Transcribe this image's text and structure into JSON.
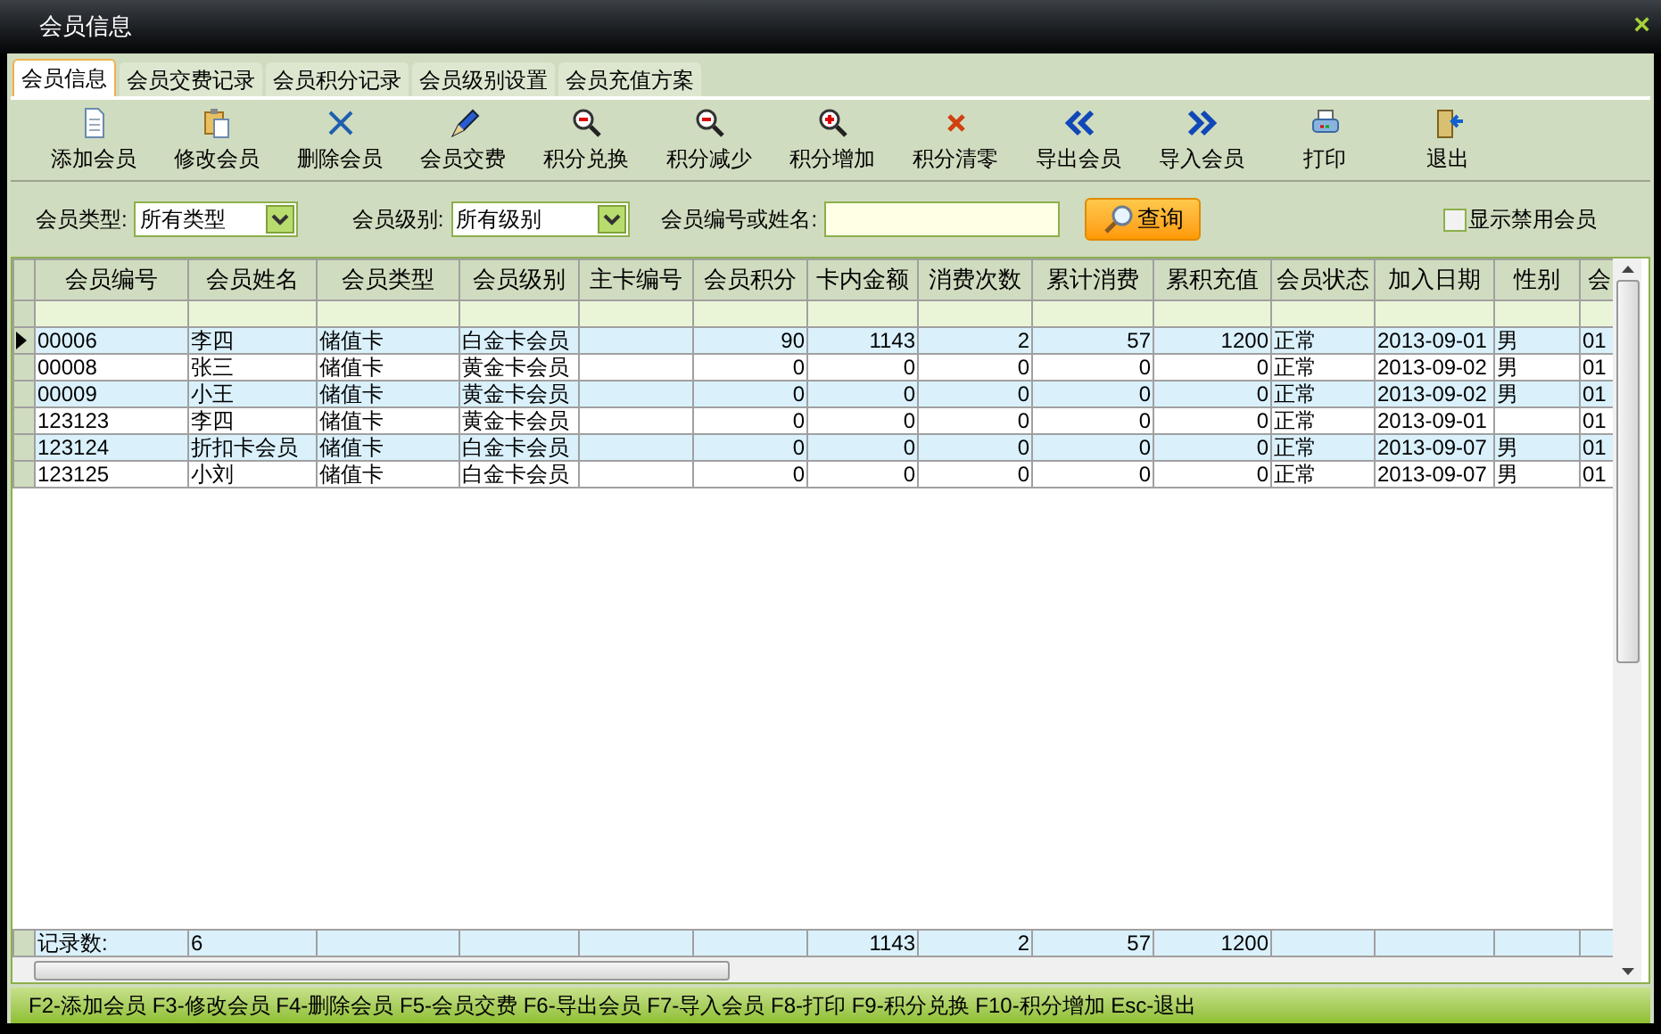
{
  "window": {
    "title": "会员信息",
    "close": "×"
  },
  "tabs": [
    {
      "label": "会员信息",
      "selected": true
    },
    {
      "label": "会员交费记录",
      "selected": false
    },
    {
      "label": "会员积分记录",
      "selected": false
    },
    {
      "label": "会员级别设置",
      "selected": false
    },
    {
      "label": "会员充值方案",
      "selected": false
    }
  ],
  "toolbar": [
    {
      "label": "添加会员",
      "kind": "document"
    },
    {
      "label": "修改会员",
      "kind": "clipboard"
    },
    {
      "label": "删除会员",
      "kind": "cross"
    },
    {
      "label": "会员交费",
      "kind": "pen"
    },
    {
      "label": "积分兑换",
      "kind": "zoom-minus"
    },
    {
      "label": "积分减少",
      "kind": "zoom-minus"
    },
    {
      "label": "积分增加",
      "kind": "zoom-plus"
    },
    {
      "label": "积分清零",
      "kind": "cross-bold"
    },
    {
      "label": "导出会员",
      "kind": "chevrons-left"
    },
    {
      "label": "导入会员",
      "kind": "chevrons-right"
    },
    {
      "label": "打印",
      "kind": "printer"
    },
    {
      "label": "退出",
      "kind": "door"
    }
  ],
  "filters": {
    "type_label": "会员类型:",
    "type_value": "所有类型",
    "level_label": "会员级别:",
    "level_value": "所有级别",
    "search_label": "会员编号或姓名:",
    "search_button": "查询",
    "show_disabled": {
      "label": "显示禁用会员",
      "checked": false
    }
  },
  "table": {
    "columns": [
      "会员编号",
      "会员姓名",
      "会员类型",
      "会员级别",
      "主卡编号",
      "会员积分",
      "卡内金额",
      "消费次数",
      "累计消费",
      "累积充值",
      "会员状态",
      "加入日期",
      "性别",
      "会"
    ],
    "rows": [
      {
        "selected": true,
        "cells": [
          "00006",
          "李四",
          "储值卡",
          "白金卡会员",
          "",
          "90",
          "1143",
          "2",
          "57",
          "1200",
          "正常",
          "2013-09-01",
          "男",
          "01"
        ]
      },
      {
        "selected": false,
        "cells": [
          "00008",
          "张三",
          "储值卡",
          "黄金卡会员",
          "",
          "0",
          "0",
          "0",
          "0",
          "0",
          "正常",
          "2013-09-02",
          "男",
          "01"
        ]
      },
      {
        "selected": false,
        "cells": [
          "00009",
          "小王",
          "储值卡",
          "黄金卡会员",
          "",
          "0",
          "0",
          "0",
          "0",
          "0",
          "正常",
          "2013-09-02",
          "男",
          "01"
        ]
      },
      {
        "selected": false,
        "cells": [
          "123123",
          "李四",
          "储值卡",
          "黄金卡会员",
          "",
          "0",
          "0",
          "0",
          "0",
          "0",
          "正常",
          "2013-09-01",
          "",
          "01"
        ]
      },
      {
        "selected": false,
        "cells": [
          "123124",
          "折扣卡会员",
          "储值卡",
          "白金卡会员",
          "",
          "0",
          "0",
          "0",
          "0",
          "0",
          "正常",
          "2013-09-07",
          "男",
          "01"
        ]
      },
      {
        "selected": false,
        "cells": [
          "123125",
          "小刘",
          "储值卡",
          "白金卡会员",
          "",
          "0",
          "0",
          "0",
          "0",
          "0",
          "正常",
          "2013-09-07",
          "男",
          "01"
        ]
      }
    ],
    "footer": {
      "label": "记录数:",
      "record_count": "6",
      "card_balance": "1143",
      "purchase_count": "2",
      "total_spent": "57",
      "total_recharged": "1200"
    }
  },
  "status_bar": "F2-添加会员 F3-修改会员 F4-删除会员 F5-会员交费 F6-导出会员 F7-导入会员 F8-打印 F9-积分兑换 F10-积分增加 Esc-退出"
}
